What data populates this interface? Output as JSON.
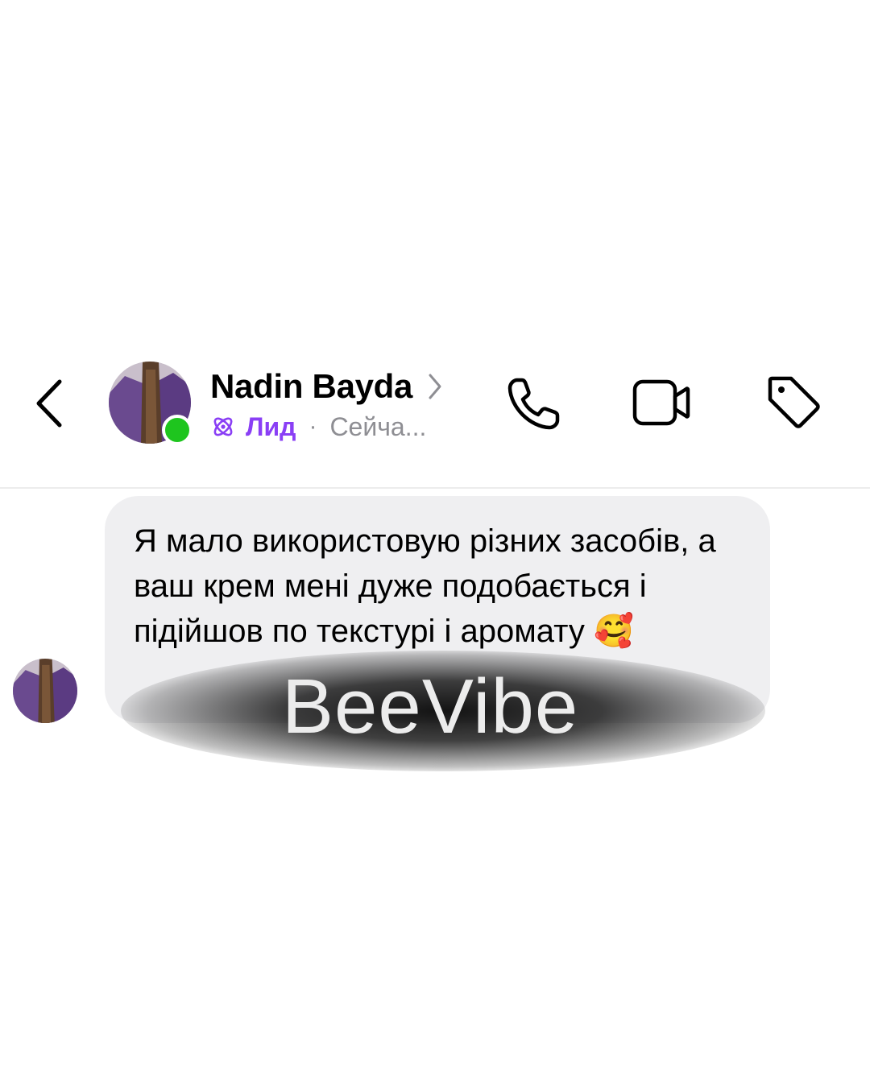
{
  "header": {
    "contact_name": "Nadin Bayda",
    "lead_label": "Лид",
    "separator": "·",
    "status": "Сейча...",
    "online": true,
    "icons": {
      "back": "chevron-left-icon",
      "profile": "chevron-right-icon",
      "lead": "atom-icon",
      "call": "phone-icon",
      "video": "video-camera-icon",
      "tag": "tag-icon"
    }
  },
  "message": {
    "text": "Я мало використовую різних засобів, а ваш крем мені дуже подобається і підійшов по текстурі і аромату 🥰"
  },
  "watermark": "BeeVibe",
  "colors": {
    "lead_purple": "#8a3ff5",
    "online_green": "#1ec51e",
    "bubble_bg": "#efeff1",
    "secondary_text": "#8e8e93"
  }
}
